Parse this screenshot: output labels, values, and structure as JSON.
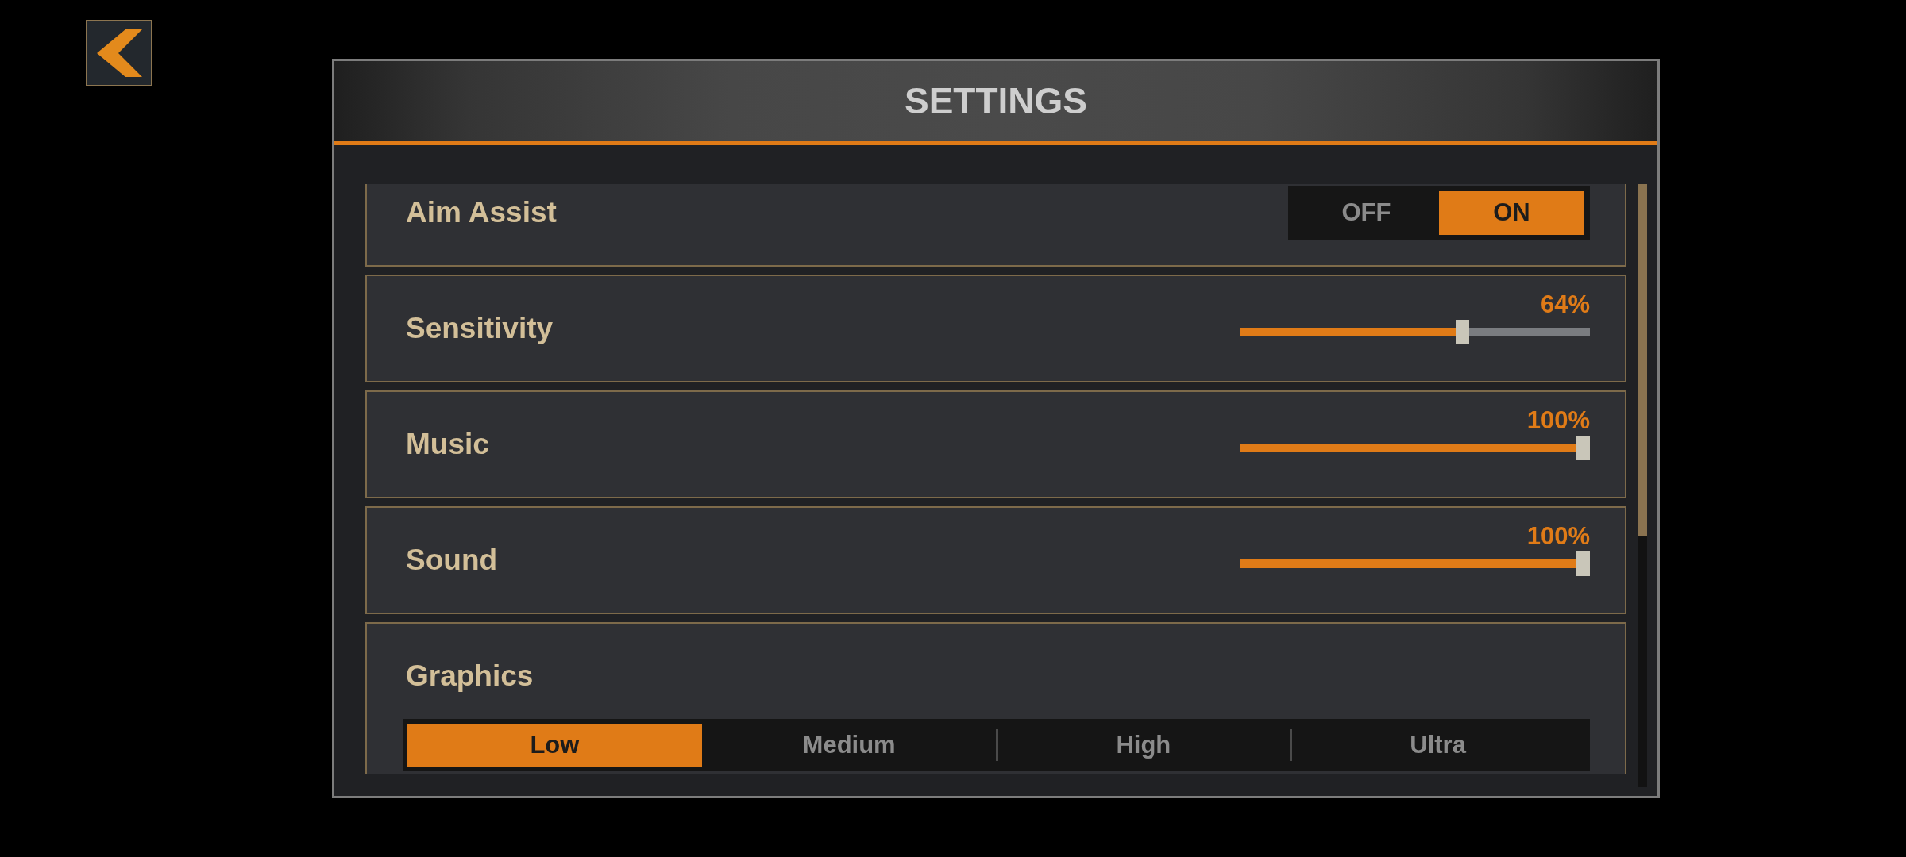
{
  "window": {
    "title": "SETTINGS"
  },
  "settings": [
    {
      "kind": "toggle",
      "label": "Aim Assist",
      "options": [
        {
          "label": "OFF",
          "selected": false
        },
        {
          "label": "ON",
          "selected": true
        }
      ]
    },
    {
      "kind": "slider",
      "label": "Sensitivity",
      "level": 0.64,
      "reading": "64%"
    },
    {
      "kind": "slider",
      "label": "Music",
      "level": 1,
      "reading": "100%"
    },
    {
      "kind": "slider",
      "label": "Sound",
      "level": 1,
      "reading": "100%"
    },
    {
      "kind": "choice",
      "label": "Graphics",
      "options": [
        {
          "label": "Low",
          "selected": true
        },
        {
          "label": "Medium",
          "selected": false
        },
        {
          "label": "High",
          "selected": false
        },
        {
          "label": "Ultra",
          "selected": false
        }
      ]
    }
  ]
}
